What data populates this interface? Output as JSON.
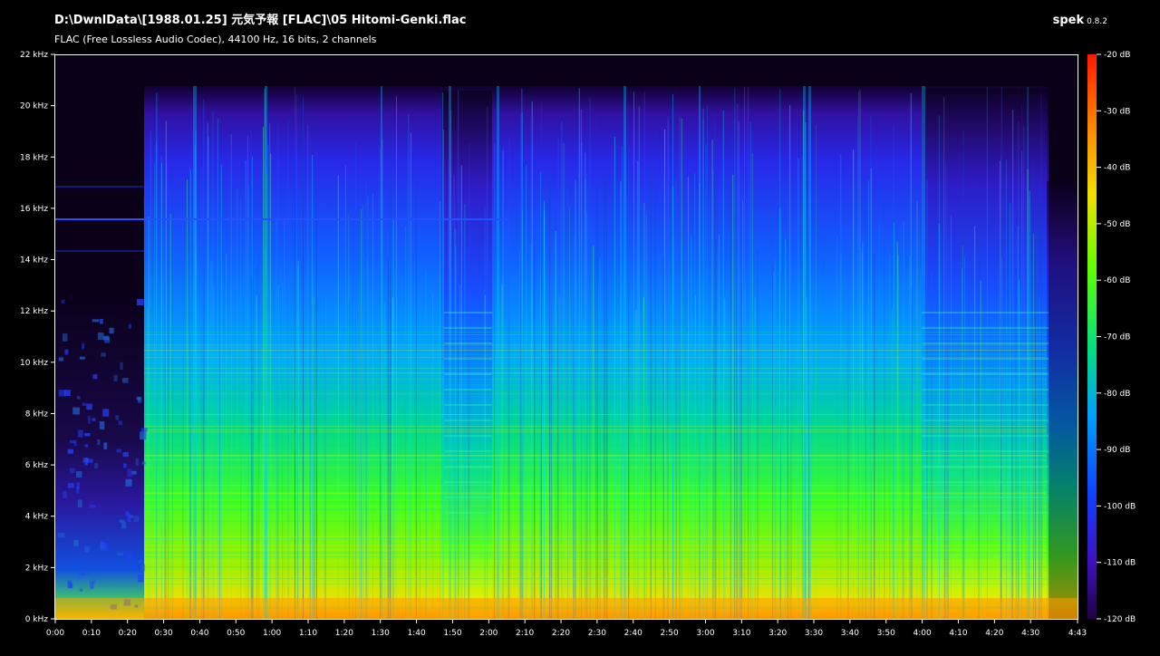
{
  "header": {
    "file_path": "D:\\DwnlData\\[1988.01.25] 元気予報 [FLAC]\\05 Hitomi-Genki.flac",
    "format_info": "FLAC (Free Lossless Audio Codec), 44100 Hz, 16 bits, 2 channels",
    "app_name": "spek",
    "app_version": "0.8.2"
  },
  "spectrogram": {
    "duration_label": "4:43",
    "freq_axis_labels": [
      "0 kHz",
      "2 kHz",
      "4 kHz",
      "6 kHz",
      "8 kHz",
      "10 kHz",
      "12 kHz",
      "14 kHz",
      "16 kHz",
      "18 kHz",
      "20 kHz",
      "22 kHz"
    ],
    "time_axis_labels": [
      "0:00",
      "0:10",
      "0:20",
      "0:30",
      "0:40",
      "0:50",
      "1:00",
      "1:10",
      "1:20",
      "1:30",
      "1:40",
      "1:50",
      "2:00",
      "2:10",
      "2:20",
      "2:30",
      "2:40",
      "2:50",
      "3:00",
      "3:10",
      "3:20",
      "3:30",
      "3:40",
      "3:50",
      "4:00",
      "4:10",
      "4:20",
      "4:30",
      "4:43"
    ],
    "db_scale_labels": [
      "-20 dB",
      "-30 dB",
      "-40 dB",
      "-50 dB",
      "-60 dB",
      "-70 dB",
      "-80 dB",
      "-90 dB",
      "-100 dB",
      "-110 dB",
      "-120 dB"
    ],
    "colors": {
      "background": "#000000",
      "axis": "#ffffff",
      "scale_gradient": [
        "#ff1800",
        "#ff8000",
        "#f0e000",
        "#60ff00",
        "#00e080",
        "#00a0ff",
        "#1040ff",
        "#4010c0",
        "#200040"
      ]
    }
  }
}
